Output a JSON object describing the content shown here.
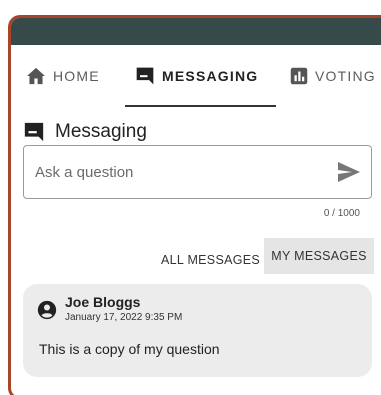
{
  "nav": {
    "tabs": [
      {
        "label": "HOME",
        "icon": "home-icon",
        "active": false
      },
      {
        "label": "MESSAGING",
        "icon": "message-icon",
        "active": true
      },
      {
        "label": "VOTING",
        "icon": "poll-icon",
        "active": false
      }
    ]
  },
  "messaging": {
    "title": "Messaging",
    "ask_placeholder": "Ask a question",
    "char_counter": "0 / 1000",
    "filters": {
      "all_label": "ALL MESSAGES",
      "mine_label": "MY MESSAGES",
      "selected": "MY MESSAGES"
    },
    "messages": [
      {
        "author": "Joe Bloggs",
        "timestamp": "January 17, 2022 9:35 PM",
        "text": "This is a copy of my question"
      }
    ]
  },
  "colors": {
    "frame_border": "#a8442a",
    "top_bar": "#354a49",
    "selected_filter_bg": "#e5e5e5",
    "message_card_bg": "#ececec"
  }
}
